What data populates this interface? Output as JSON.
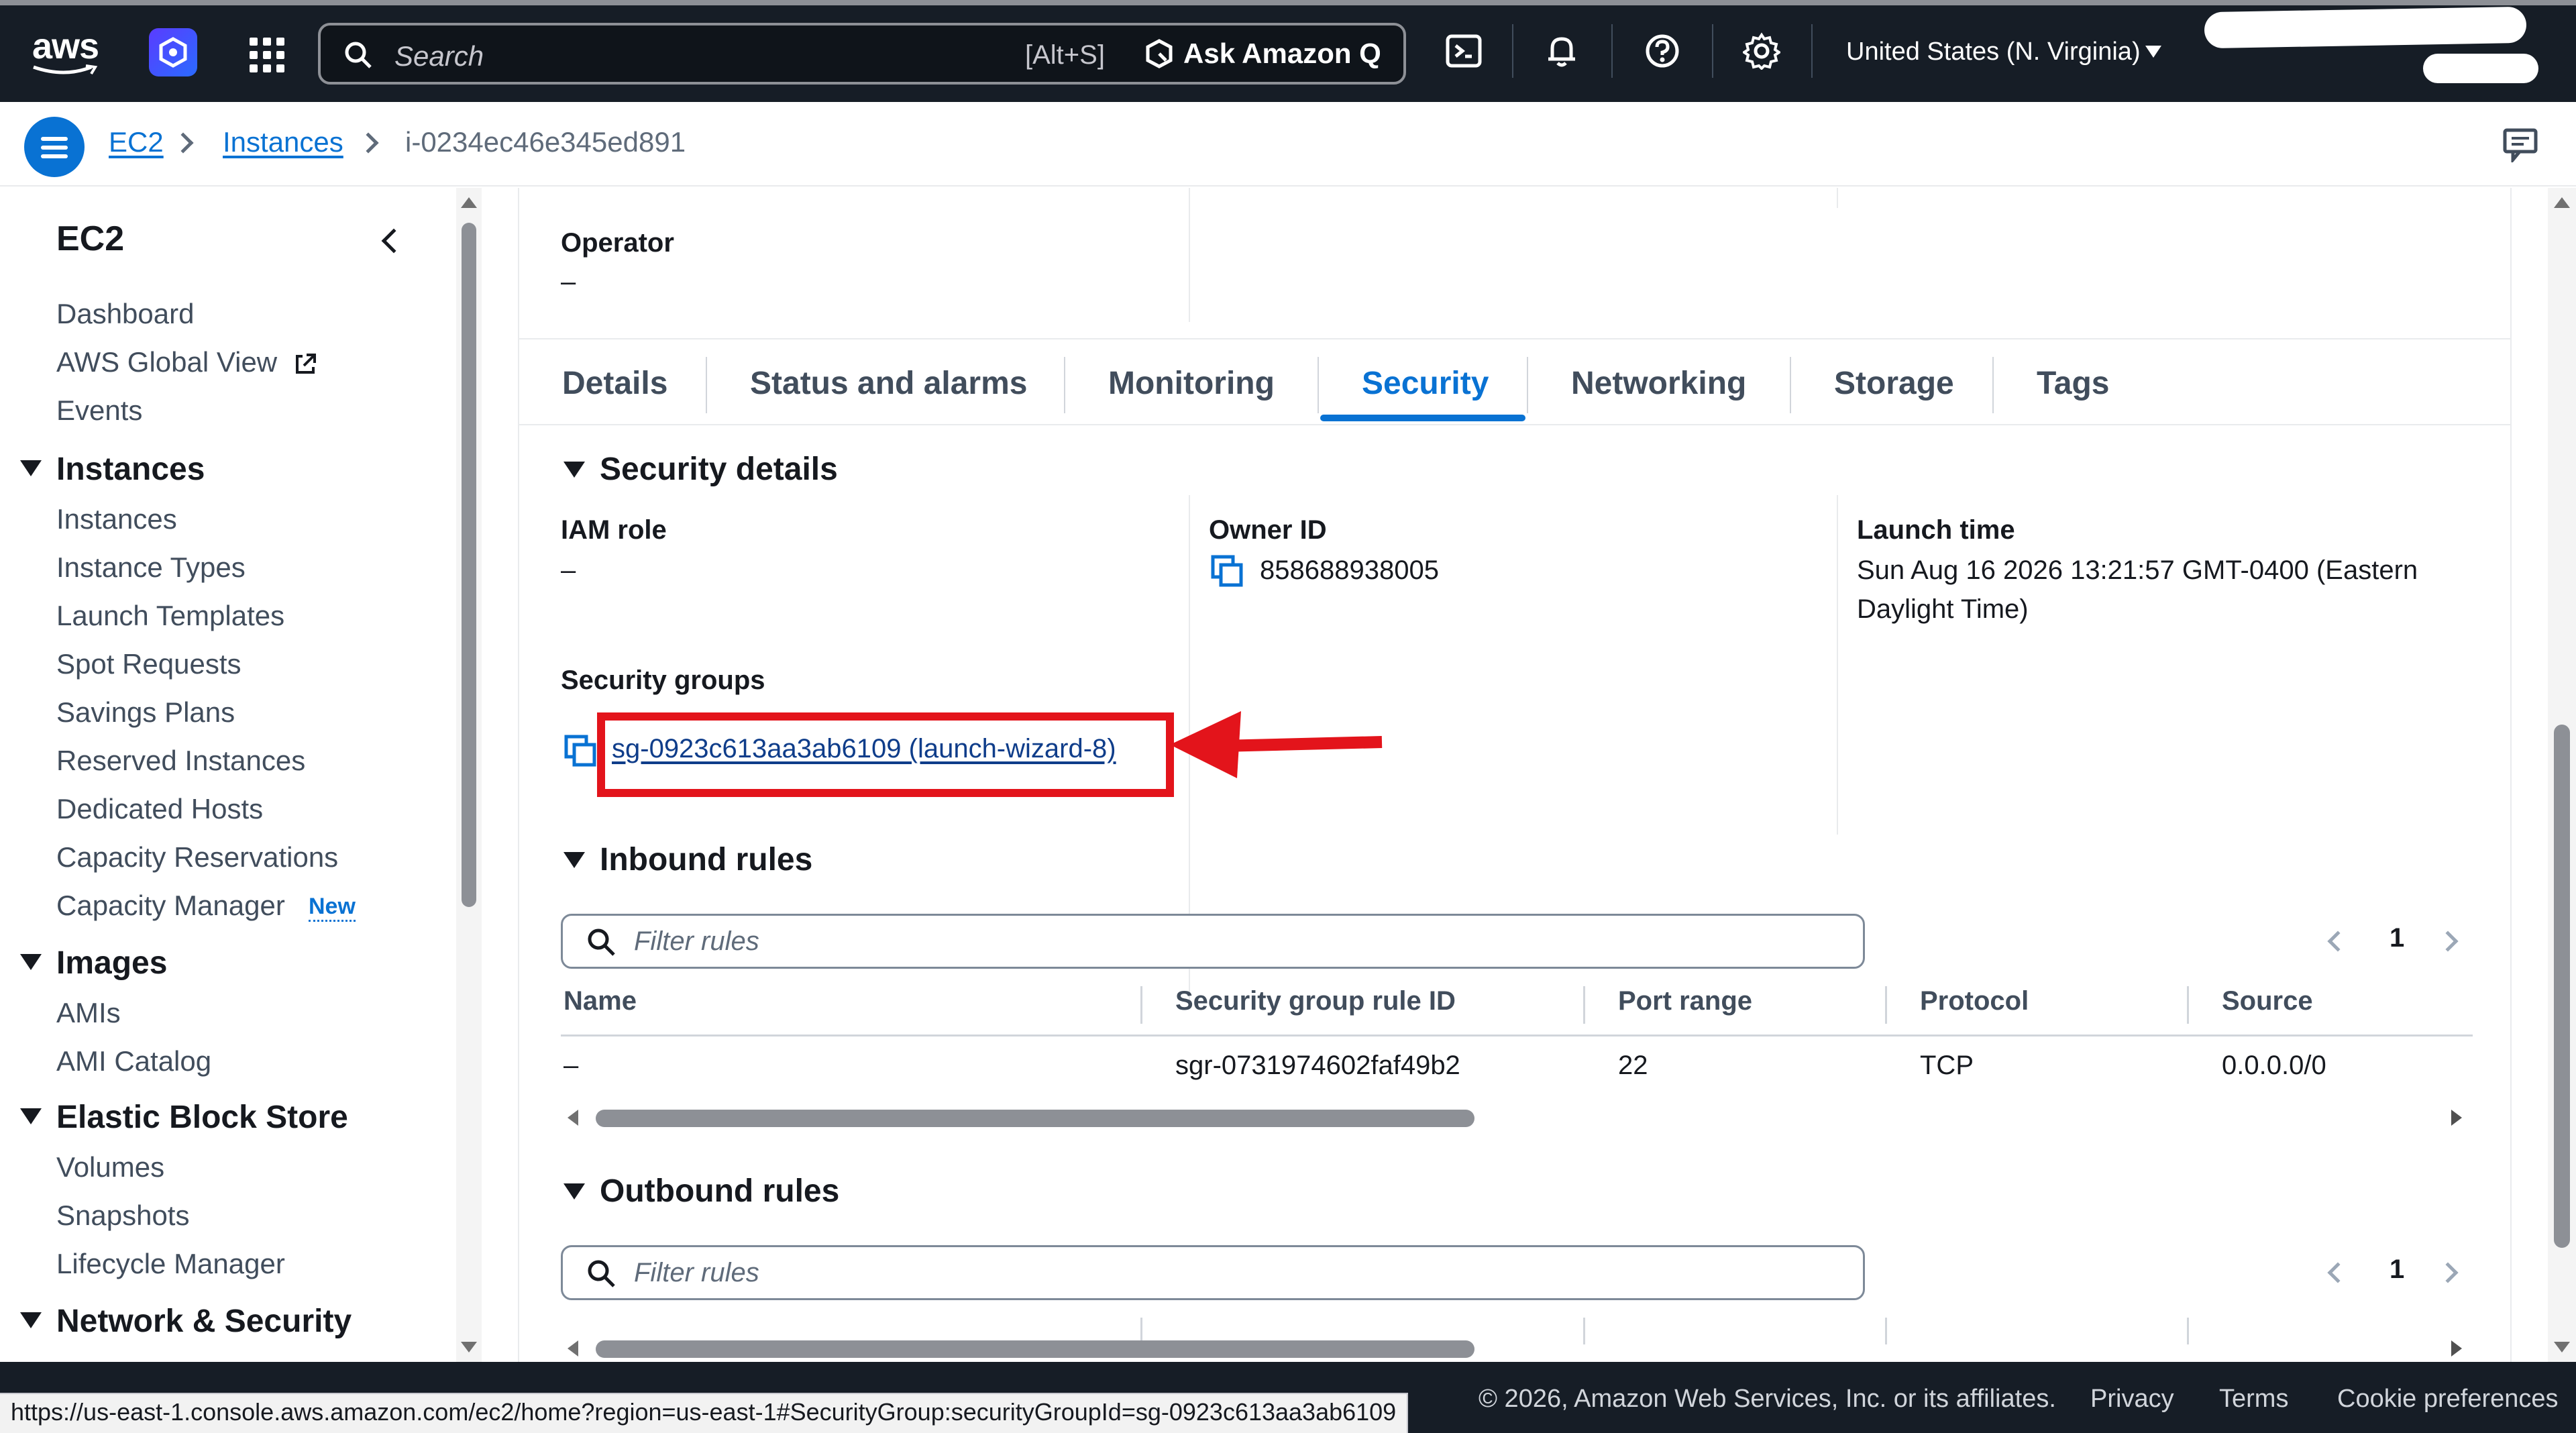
{
  "topnav": {
    "logo": "aws",
    "search_placeholder": "Search",
    "search_shortcut": "[Alt+S]",
    "ask_q": "Ask Amazon Q",
    "region": "United States (N. Virginia)"
  },
  "breadcrumb": {
    "items": [
      "EC2",
      "Instances",
      "i-0234ec46e345ed891"
    ]
  },
  "sidenav": {
    "title": "EC2",
    "top_items": [
      "Dashboard",
      "AWS Global View",
      "Events"
    ],
    "sections": [
      {
        "title": "Instances",
        "items": [
          "Instances",
          "Instance Types",
          "Launch Templates",
          "Spot Requests",
          "Savings Plans",
          "Reserved Instances",
          "Dedicated Hosts",
          "Capacity Reservations",
          "Capacity Manager"
        ]
      },
      {
        "title": "Images",
        "items": [
          "AMIs",
          "AMI Catalog"
        ]
      },
      {
        "title": "Elastic Block Store",
        "items": [
          "Volumes",
          "Snapshots",
          "Lifecycle Manager"
        ]
      },
      {
        "title": "Network & Security",
        "items": []
      }
    ],
    "new_badge": "New"
  },
  "details_top": {
    "operator_label": "Operator",
    "operator_value": "–"
  },
  "tabs": [
    "Details",
    "Status and alarms",
    "Monitoring",
    "Security",
    "Networking",
    "Storage",
    "Tags"
  ],
  "active_tab": "Security",
  "security_details": {
    "title": "Security details",
    "iam_role_label": "IAM role",
    "iam_role_value": "–",
    "owner_id_label": "Owner ID",
    "owner_id_value": "858688938005",
    "launch_time_label": "Launch time",
    "launch_time_line1": "Sun Aug 16 2026 13:21:57 GMT-0400 (Eastern",
    "launch_time_line2": "Daylight Time)",
    "security_groups_label": "Security groups",
    "security_group_link": "sg-0923c613aa3ab6109 (launch-wizard-8)"
  },
  "inbound": {
    "title": "Inbound rules",
    "filter_placeholder": "Filter rules",
    "page": "1",
    "columns": [
      "Name",
      "Security group rule ID",
      "Port range",
      "Protocol",
      "Source"
    ],
    "rows": [
      [
        "–",
        "sgr-0731974602faf49b2",
        "22",
        "TCP",
        "0.0.0.0/0"
      ]
    ]
  },
  "outbound": {
    "title": "Outbound rules",
    "filter_placeholder": "Filter rules",
    "page": "1"
  },
  "footer": {
    "copyright": "© 2026, Amazon Web Services, Inc. or its affiliates.",
    "privacy": "Privacy",
    "terms": "Terms",
    "cookies": "Cookie preferences"
  },
  "status_url": "https://us-east-1.console.aws.amazon.com/ec2/home?region=us-east-1#SecurityGroup:securityGroupId=sg-0923c613aa3ab6109",
  "colors": {
    "nav_bg": "#161d26",
    "link": "#0972d3",
    "annotation_red": "#e3141b"
  }
}
